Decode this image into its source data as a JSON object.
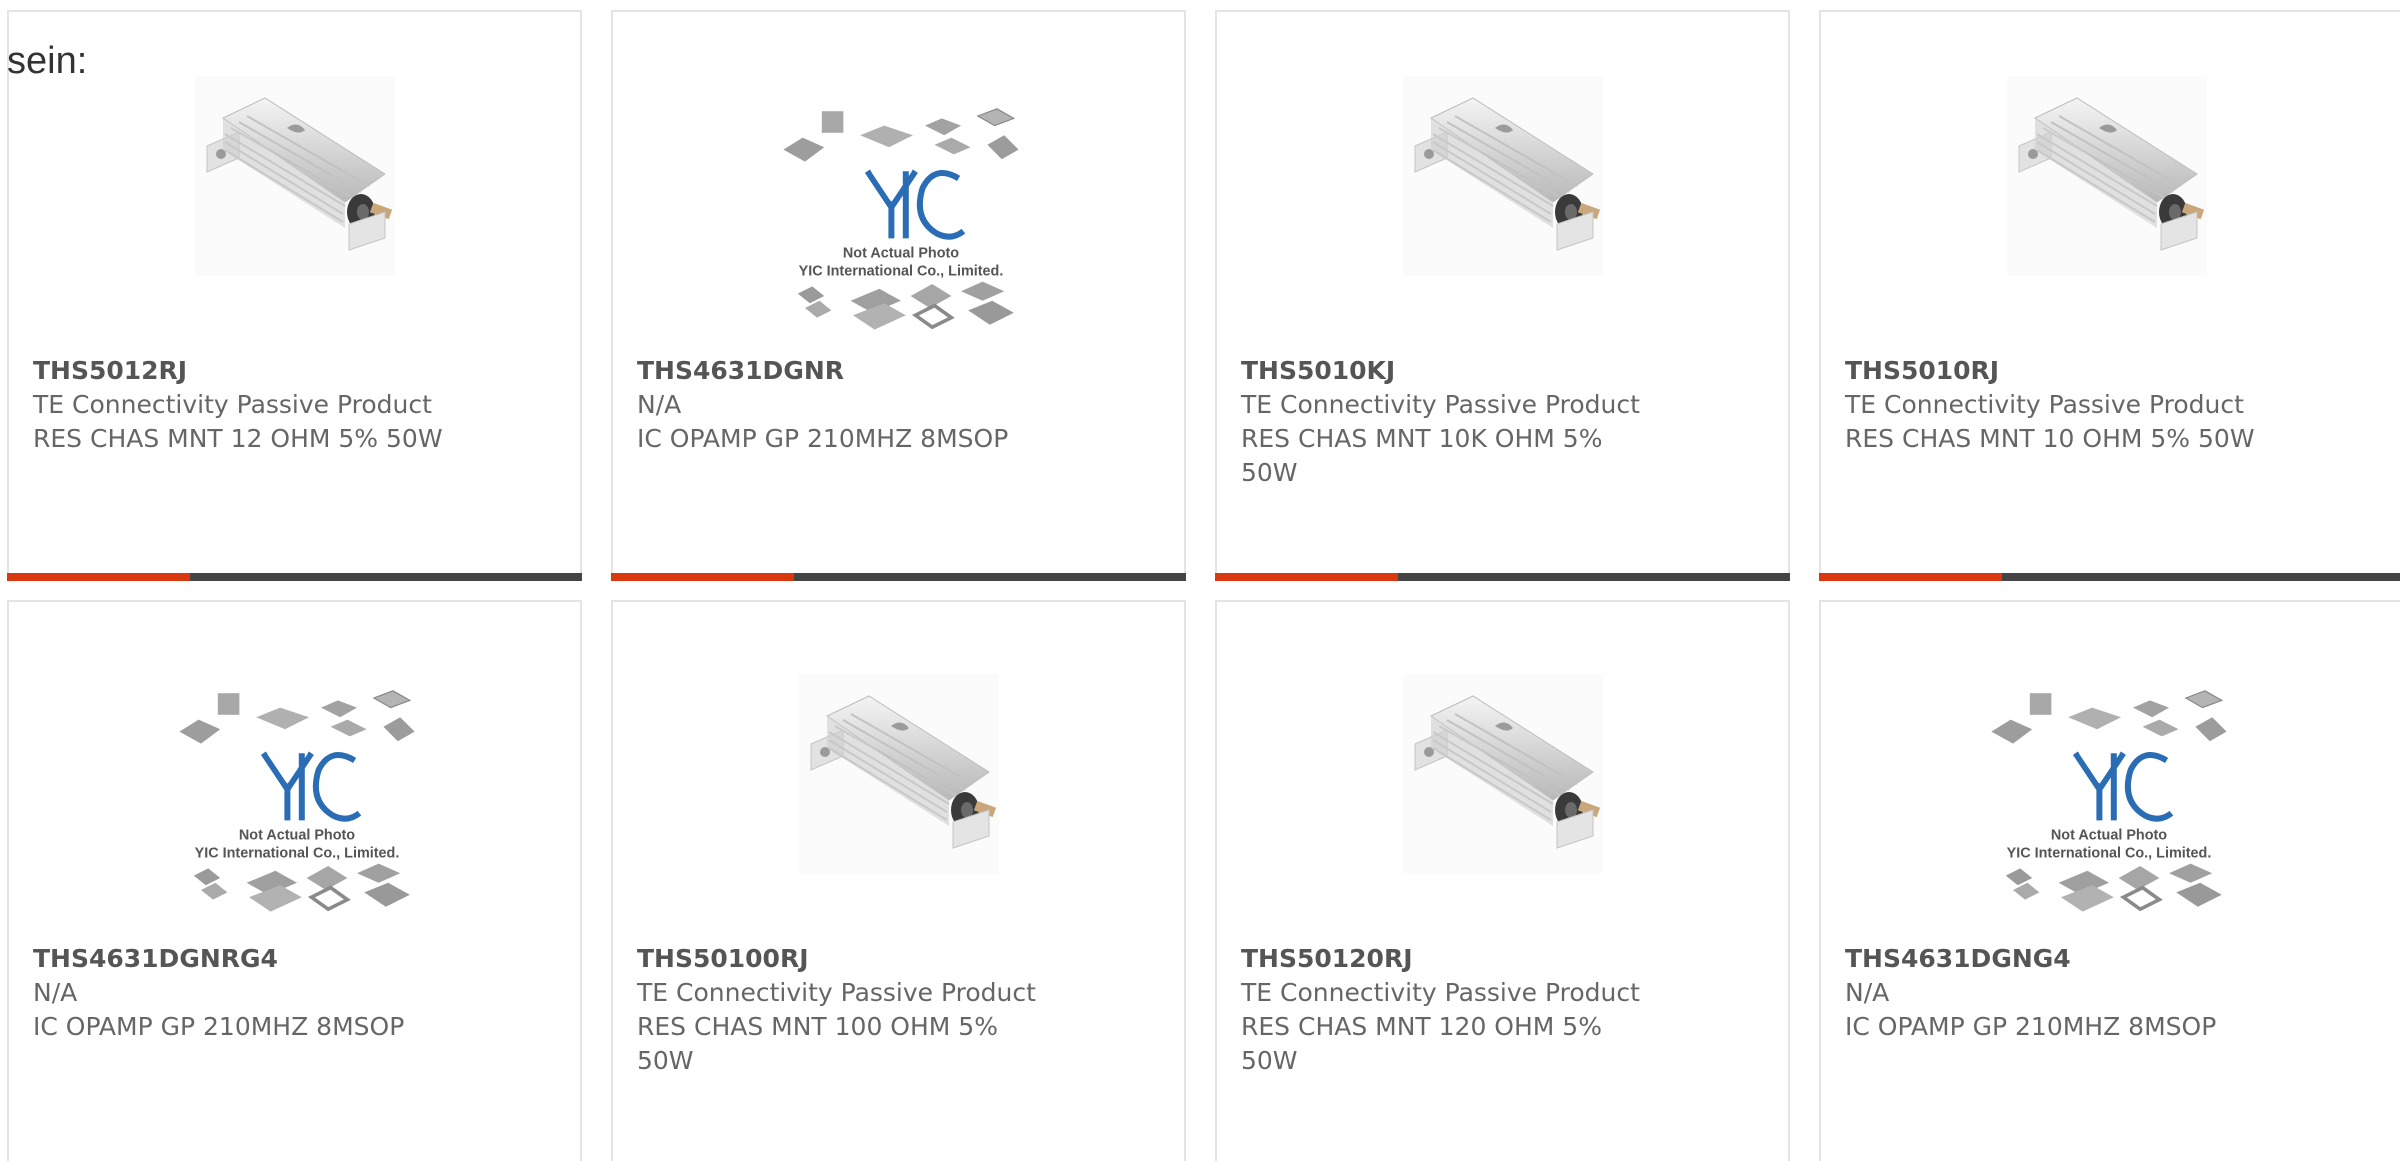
{
  "intro_text": "sein:",
  "colors": {
    "accent": "#d9390f",
    "bar": "#444444",
    "border": "#e4e4e4",
    "logo_blue": "#2a6db5"
  },
  "products": [
    {
      "part_number": "THS5012RJ",
      "manufacturer": "TE Connectivity Passive Product",
      "description": "RES CHAS MNT 12 OHM 5% 50W",
      "image": "resistor-photo-icon"
    },
    {
      "part_number": "THS4631DGNR",
      "manufacturer": "N/A",
      "description": "IC OPAMP GP 210MHZ 8MSOP",
      "image": "yic-placeholder-icon",
      "image_caption_1": "Not Actual Photo",
      "image_caption_2": "YIC International Co., Limited."
    },
    {
      "part_number": "THS5010KJ",
      "manufacturer": "TE Connectivity Passive Product",
      "description": "RES CHAS MNT 10K OHM 5% 50W",
      "image": "resistor-photo-icon"
    },
    {
      "part_number": "THS5010RJ",
      "manufacturer": "TE Connectivity Passive Product",
      "description": "RES CHAS MNT 10 OHM 5% 50W",
      "image": "resistor-photo-icon"
    },
    {
      "part_number": "THS4631DGNRG4",
      "manufacturer": "N/A",
      "description": "IC OPAMP GP 210MHZ 8MSOP",
      "image": "yic-placeholder-icon",
      "image_caption_1": "Not Actual Photo",
      "image_caption_2": "YIC International Co., Limited."
    },
    {
      "part_number": "THS50100RJ",
      "manufacturer": "TE Connectivity Passive Product",
      "description": "RES CHAS MNT 100 OHM 5% 50W",
      "image": "resistor-photo-icon"
    },
    {
      "part_number": "THS50120RJ",
      "manufacturer": "TE Connectivity Passive Product",
      "description": "RES CHAS MNT 120 OHM 5% 50W",
      "image": "resistor-photo-icon"
    },
    {
      "part_number": "THS4631DGNG4",
      "manufacturer": "N/A",
      "description": "IC OPAMP GP 210MHZ 8MSOP",
      "image": "yic-placeholder-icon",
      "image_caption_1": "Not Actual Photo",
      "image_caption_2": "YIC International Co., Limited."
    }
  ]
}
